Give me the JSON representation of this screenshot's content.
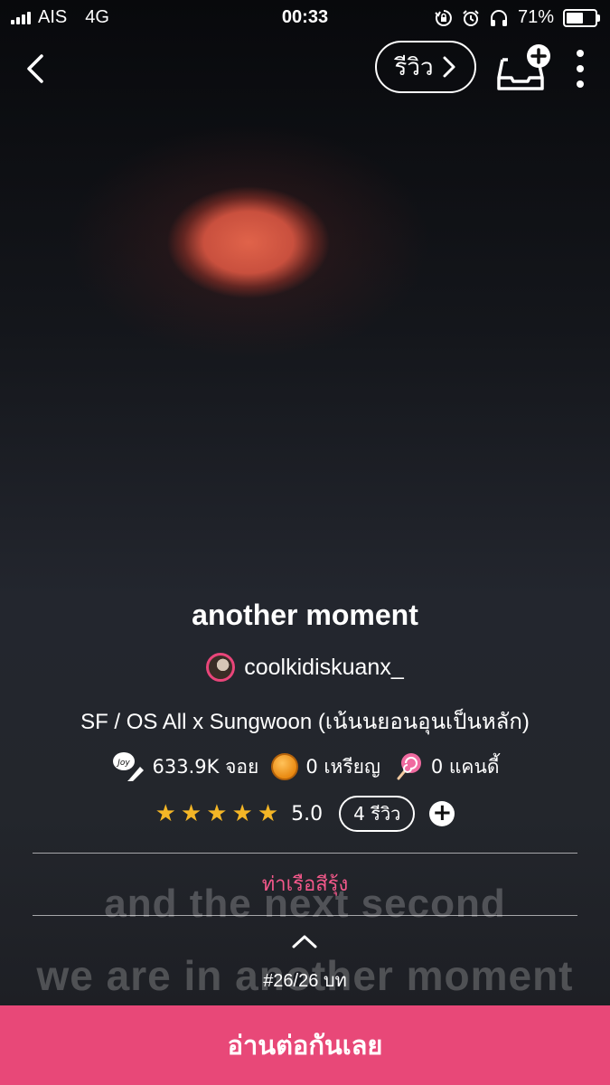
{
  "status_bar": {
    "carrier": "AIS",
    "network": "4G",
    "time": "00:33",
    "battery_percent": "71%",
    "battery_level": 0.71,
    "icons": [
      "orientation-lock-icon",
      "alarm-icon",
      "headphones-icon",
      "battery-icon"
    ]
  },
  "nav": {
    "review_label": "รีวิว",
    "icons": [
      "back-chevron-icon",
      "chevron-right-icon",
      "add-to-library-icon",
      "more-vertical-icon"
    ]
  },
  "background_text": {
    "line1": "and the next second",
    "line2": "we are in another moment"
  },
  "story": {
    "title": "another moment",
    "author": "coolkidiskuanx_",
    "genre": "SF / OS All x Sungwoon (เน้นนยอนอุนเป็นหลัก)",
    "stats": {
      "reads": "633.9K จอย",
      "coins": "0 เหรียญ",
      "candies": "0 แคนดี้"
    },
    "rating": {
      "stars": 5,
      "value": "5.0",
      "reviews_label": "4 รีวิว"
    },
    "publisher": "ท่าเรือสีรุ้ง",
    "chapter": "#26/26 บท"
  },
  "cta": {
    "label": "อ่านต่อกันเลย"
  },
  "colors": {
    "accent": "#e84878",
    "publisher": "#f2588a",
    "star": "#f4b626"
  }
}
